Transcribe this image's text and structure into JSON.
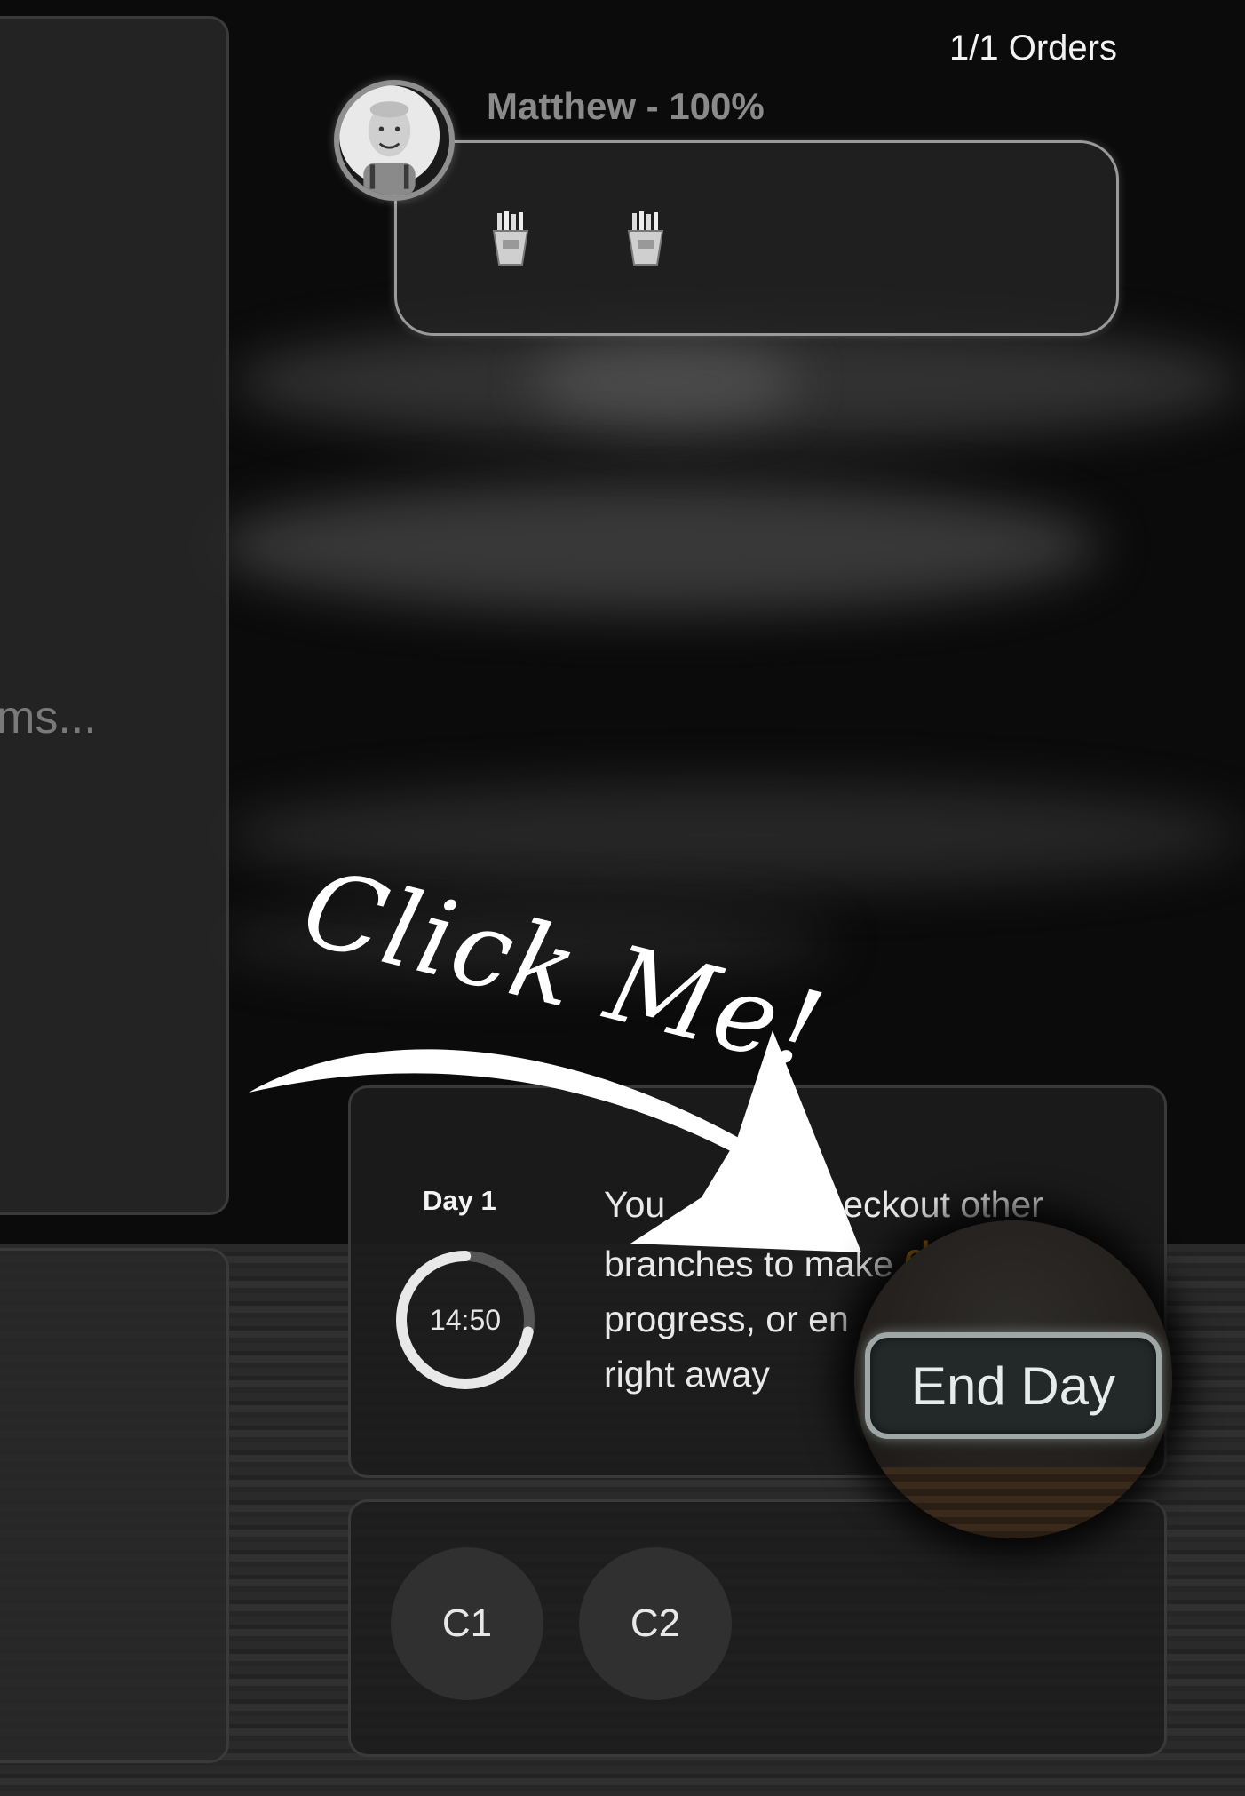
{
  "orders": {
    "count_label": "1/1 Orders"
  },
  "customer": {
    "name_label": "Matthew - 100%"
  },
  "order": {
    "items": [
      "fries-icon",
      "fries-icon"
    ]
  },
  "left_panel": {
    "loading_text": "ms..."
  },
  "day": {
    "label": "Day 1",
    "timer": "14:50",
    "timer_progress": 0.72
  },
  "tutorial": {
    "line1_visible": "You",
    "line1_end": "eckout other",
    "line2_start": "branches to make",
    "line2_highlight": "day",
    "line3": "progress, or en",
    "line4": "right away",
    "callout": "Click Me!",
    "highlight_color": "#f0a01a"
  },
  "end_day_button": {
    "label": "End Day"
  },
  "counters": [
    {
      "label": "C1"
    },
    {
      "label": "C2"
    }
  ]
}
